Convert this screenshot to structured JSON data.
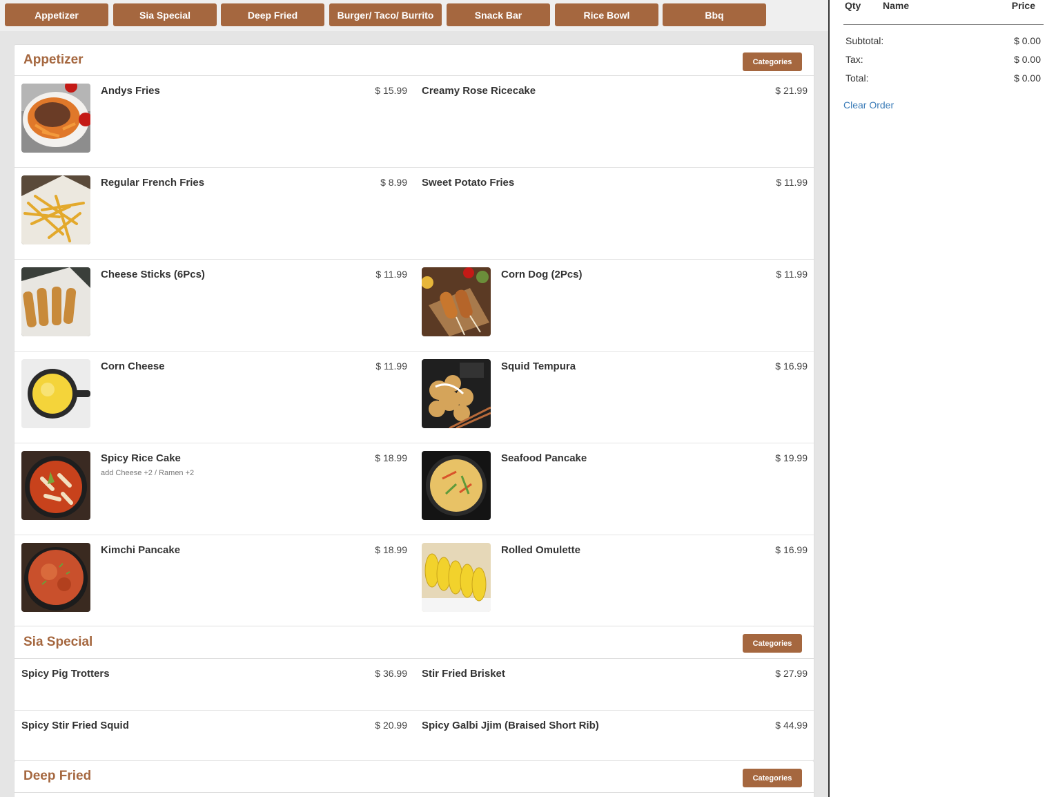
{
  "categories": [
    "Appetizer",
    "Sia Special",
    "Deep Fried",
    "Burger/ Taco/ Burrito",
    "Snack Bar",
    "Rice Bowl",
    "Bbq"
  ],
  "categories_button_label": "Categories",
  "sections": [
    {
      "title": "Appetizer",
      "items": [
        {
          "name": "Andys Fries",
          "price": "$ 15.99",
          "icon": "loaded-fries-photo"
        },
        {
          "name": "Creamy Rose Ricecake",
          "price": "$ 21.99"
        },
        {
          "name": "Regular French Fries",
          "price": "$ 8.99",
          "icon": "french-fries-photo"
        },
        {
          "name": "Sweet Potato Fries",
          "price": "$ 11.99"
        },
        {
          "name": "Cheese Sticks (6Pcs)",
          "price": "$ 11.99",
          "icon": "cheese-sticks-photo"
        },
        {
          "name": "Corn Dog (2Pcs)",
          "price": "$ 11.99",
          "icon": "corn-dog-photo"
        },
        {
          "name": "Corn Cheese",
          "price": "$ 11.99",
          "icon": "corn-cheese-photo"
        },
        {
          "name": "Squid Tempura",
          "price": "$ 16.99",
          "icon": "squid-tempura-photo"
        },
        {
          "name": "Spicy Rice Cake",
          "price": "$ 18.99",
          "description": "add Cheese +2 / Ramen +2",
          "icon": "spicy-rice-cake-photo"
        },
        {
          "name": "Seafood Pancake",
          "price": "$ 19.99",
          "icon": "seafood-pancake-photo"
        },
        {
          "name": "Kimchi Pancake",
          "price": "$ 18.99",
          "icon": "kimchi-pancake-photo"
        },
        {
          "name": "Rolled Omulette",
          "price": "$ 16.99",
          "icon": "rolled-omelette-photo"
        }
      ]
    },
    {
      "title": "Sia Special",
      "items": [
        {
          "name": "Spicy Pig Trotters",
          "price": "$ 36.99"
        },
        {
          "name": "Stir Fried Brisket",
          "price": "$ 27.99"
        },
        {
          "name": "Spicy Stir Fried Squid",
          "price": "$ 20.99"
        },
        {
          "name": "Spicy Galbi Jjim (Braised Short Rib)",
          "price": "$ 44.99"
        }
      ]
    },
    {
      "title": "Deep Fried",
      "items": []
    }
  ],
  "order": {
    "headers": {
      "qty": "Qty",
      "name": "Name",
      "price": "Price"
    },
    "summary": [
      {
        "label": "Subtotal:",
        "value": "$ 0.00"
      },
      {
        "label": "Tax:",
        "value": "$ 0.00"
      },
      {
        "label": "Total:",
        "value": "$ 0.00"
      }
    ],
    "clear_label": "Clear Order"
  },
  "colors": {
    "accent": "#a5673f",
    "link": "#3b7cb8"
  }
}
